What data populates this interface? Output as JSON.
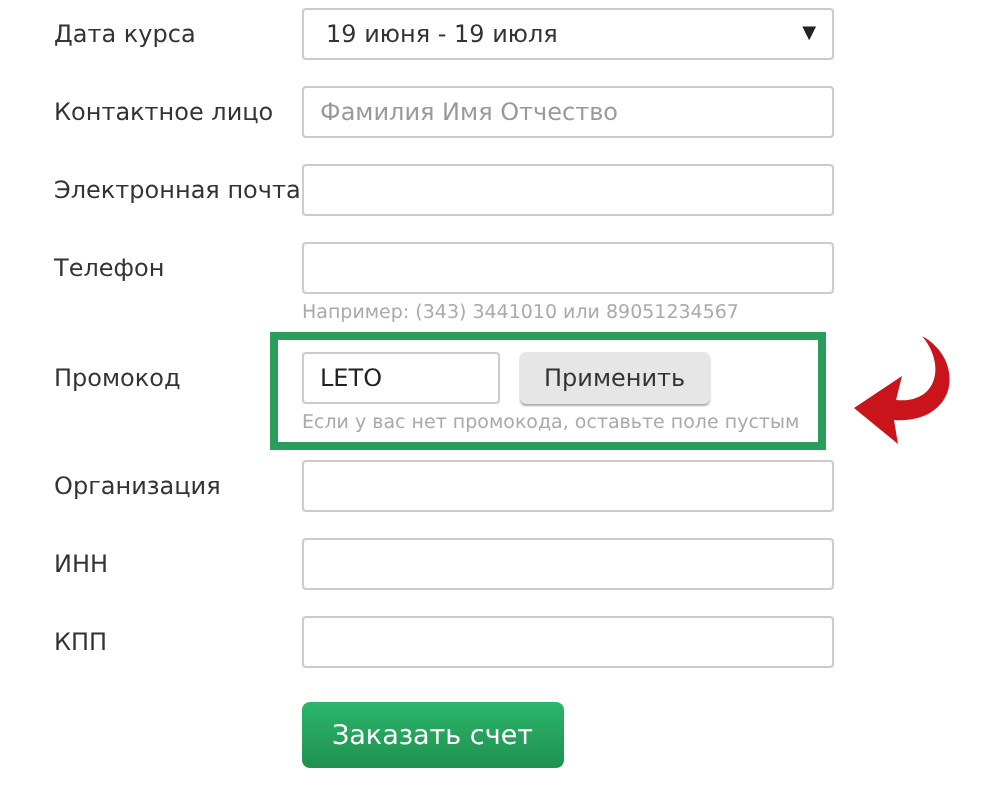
{
  "fields": [
    {
      "kind": "select",
      "label": "Дата курса",
      "value": "19 июня - 19 июля",
      "caret": "▼"
    },
    {
      "kind": "text",
      "label": "Контактное лицо",
      "placeholder": "Фамилия Имя Отчество"
    },
    {
      "kind": "text",
      "label": "Электронная почта"
    },
    {
      "kind": "text",
      "label": "Телефон",
      "hint": "Например: (343) 3441010 или 89051234567"
    },
    {
      "kind": "promo",
      "label": "Промокод",
      "value": "LETO",
      "button": "Применить",
      "hint": "Если у вас нет промокода, оставьте поле пустым"
    },
    {
      "kind": "text",
      "label": "Организация"
    },
    {
      "kind": "text",
      "label": "ИНН"
    },
    {
      "kind": "text",
      "label": "КПП"
    }
  ],
  "submit": "Заказать счет"
}
